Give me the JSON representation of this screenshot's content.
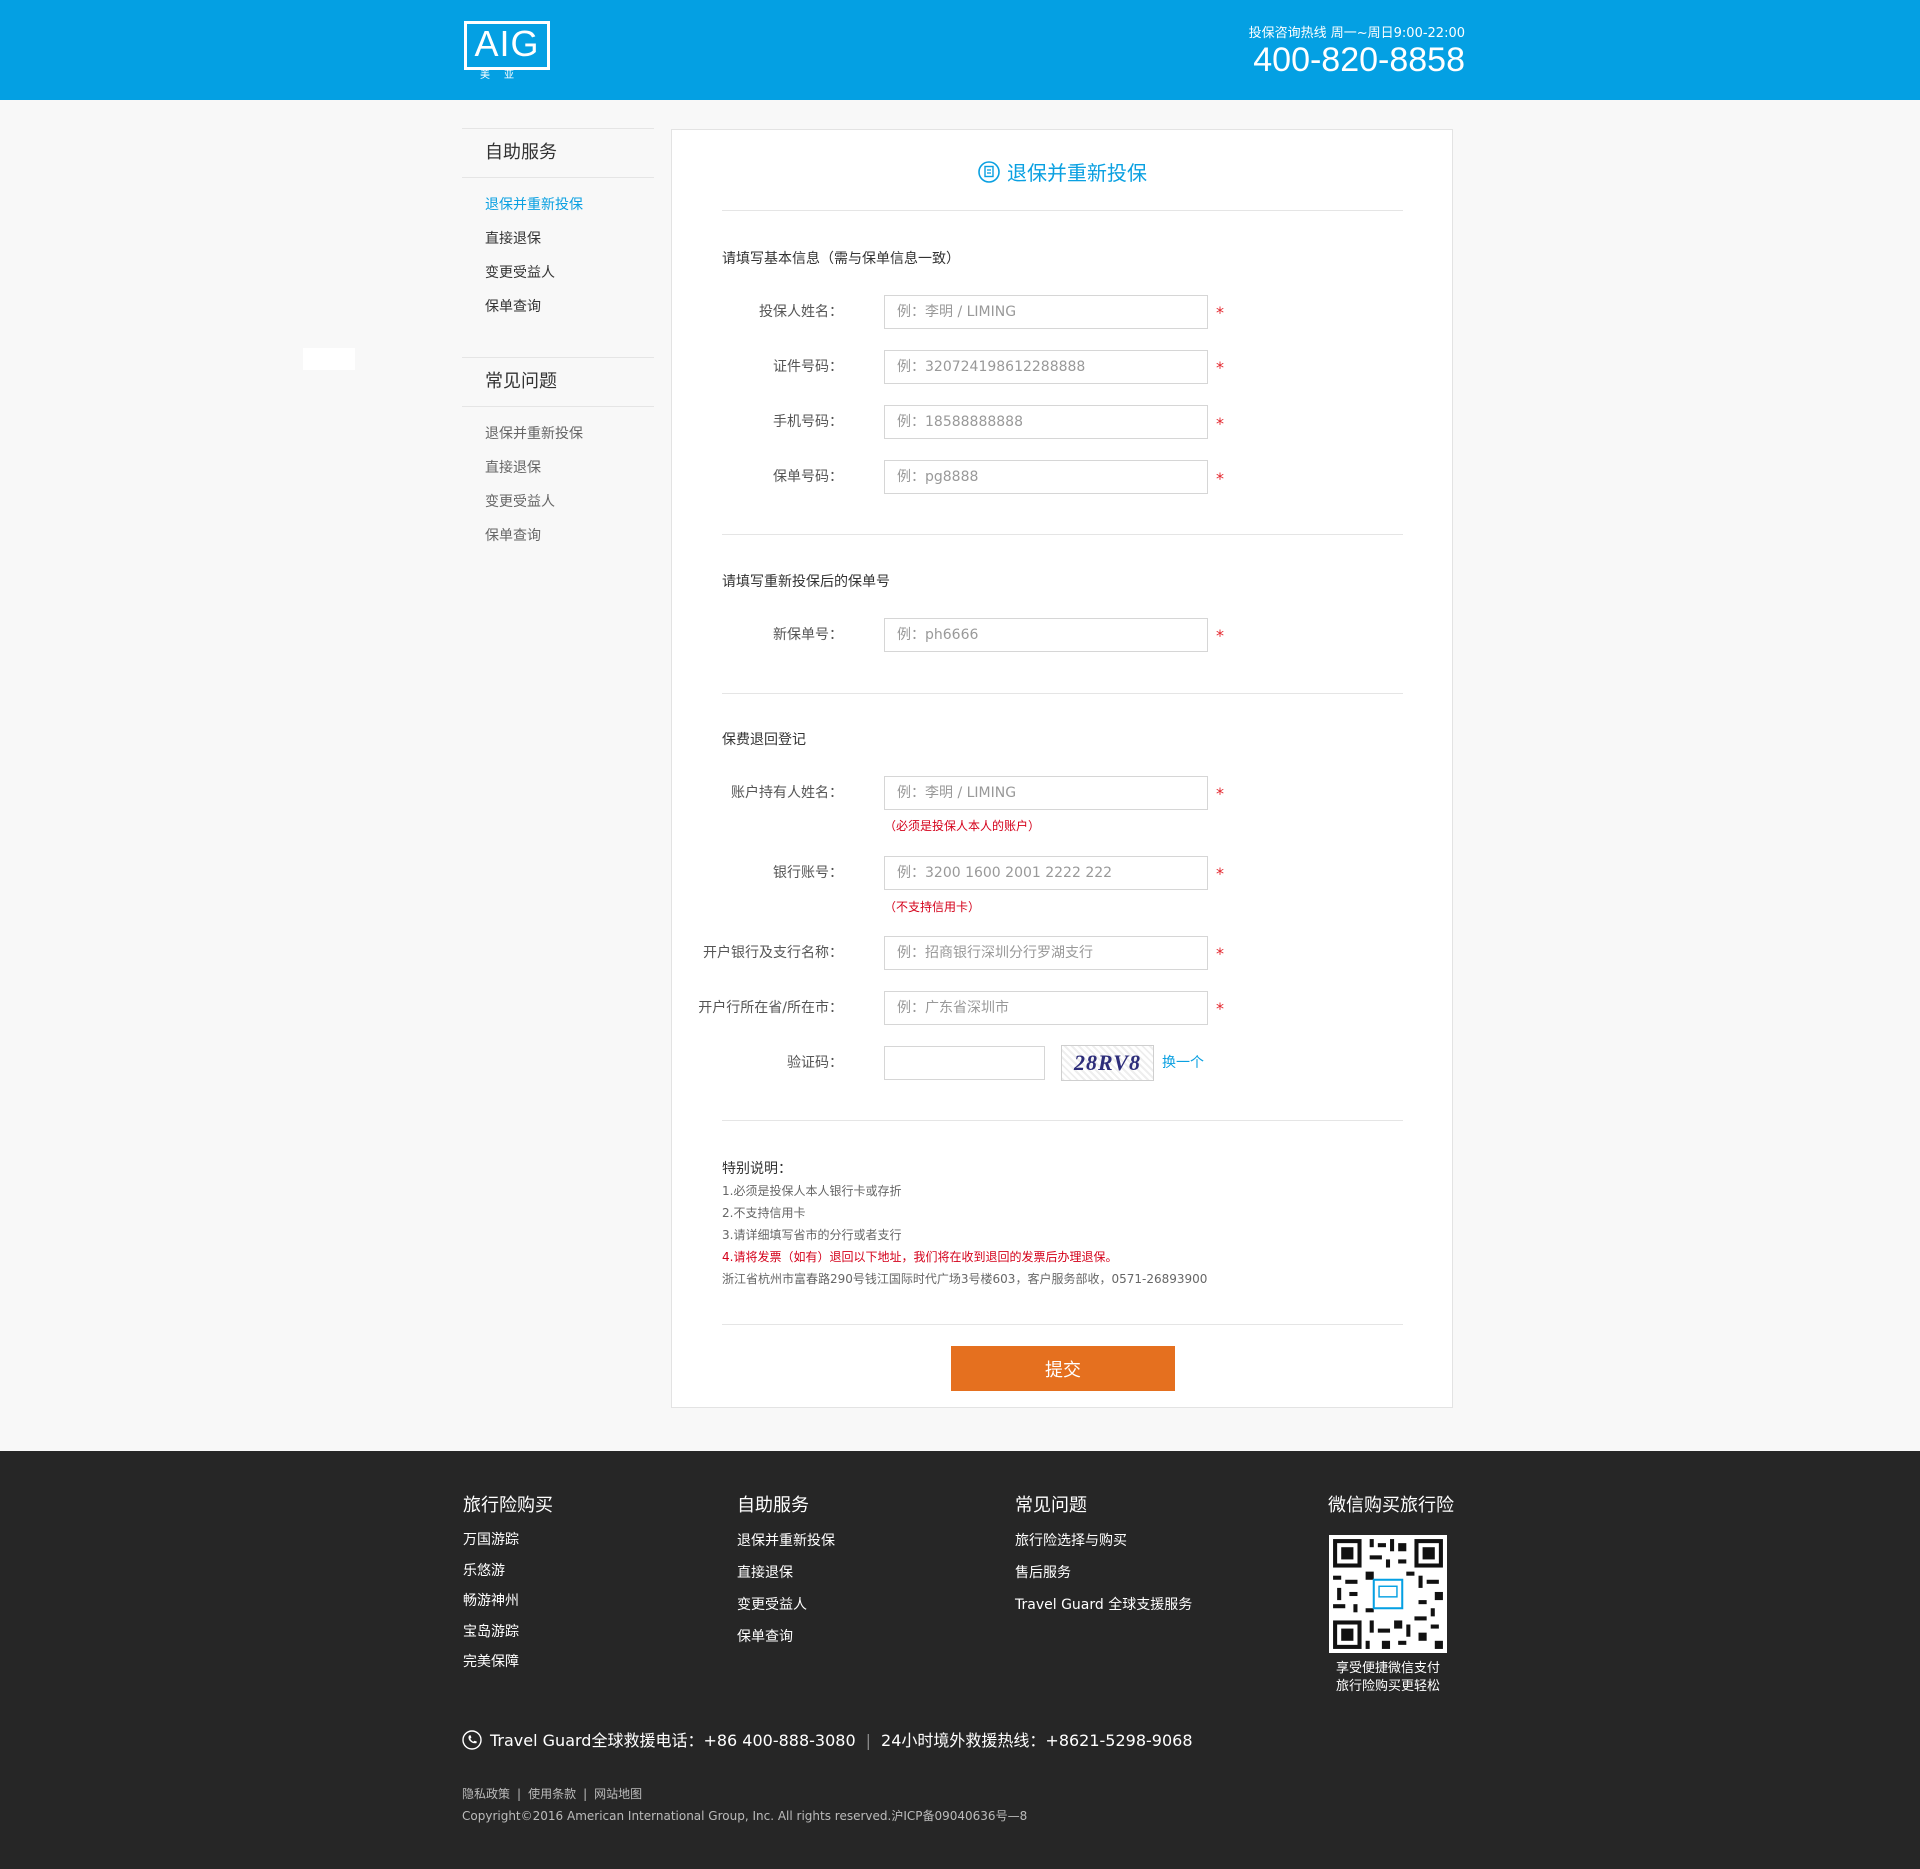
{
  "header": {
    "logo_text": "AIG",
    "logo_sub": "美亚",
    "hotline_label": "投保咨询热线 周一~周日9:00-22:00",
    "hotline_number": "400-820-8858"
  },
  "sidebar": {
    "self_service": {
      "title": "自助服务",
      "items": [
        "退保并重新投保",
        "直接退保",
        "变更受益人",
        "保单查询"
      ]
    },
    "faq": {
      "title": "常见问题",
      "items": [
        "退保并重新投保",
        "直接退保",
        "变更受益人",
        "保单查询"
      ]
    }
  },
  "form": {
    "title": "退保并重新投保",
    "basic_section": "请填写基本信息（需与保单信息一致）",
    "fields_basic": [
      {
        "label": "投保人姓名：",
        "placeholder": "例：李明 / LIMING",
        "required": "*"
      },
      {
        "label": "证件号码：",
        "placeholder": "例：320724198612288888",
        "required": "*"
      },
      {
        "label": "手机号码：",
        "placeholder": "例：18588888888",
        "required": "*"
      },
      {
        "label": "保单号码：",
        "placeholder": "例：pg8888",
        "required": "*"
      }
    ],
    "new_policy_section": "请填写重新投保后的保单号",
    "field_new_policy": {
      "label": "新保单号：",
      "placeholder": "例：ph6666",
      "required": "*"
    },
    "refund_section": "保费退回登记",
    "fields_refund": [
      {
        "label": "账户持有人姓名：",
        "placeholder": "例：李明 / LIMING",
        "required": "*",
        "hint": "（必须是投保人本人的账户）"
      },
      {
        "label": "银行账号：",
        "placeholder": "例：3200 1600 2001 2222 222",
        "required": "*",
        "hint": "（不支持信用卡）"
      },
      {
        "label": "开户银行及支行名称：",
        "placeholder": "例：招商银行深圳分行罗湖支行",
        "required": "*"
      },
      {
        "label": "开户行所在省/所在市：",
        "placeholder": "例：广东省深圳市",
        "required": "*"
      }
    ],
    "captcha": {
      "label": "验证码：",
      "value": "",
      "image_text": "28RV8",
      "swap_label": "换一个"
    },
    "notes": {
      "title": "特别说明：",
      "items": [
        "1.必须是投保人本人银行卡或存折",
        "2.不支持信用卡",
        "3.请详细填写省市的分行或者支行"
      ],
      "highlight": "4.请将发票（如有）退回以下地址，我们将在收到退回的发票后办理退保。",
      "address": "浙江省杭州市富春路290号钱江国际时代广场3号楼603，客户服务部收，0571-26893900"
    },
    "submit_label": "提交"
  },
  "footer": {
    "travel": {
      "title": "旅行险购买",
      "items": [
        "万国游踪",
        "乐悠游",
        "畅游神州",
        "宝岛游踪",
        "完美保障"
      ]
    },
    "self_service": {
      "title": "自助服务",
      "items": [
        "退保并重新投保",
        "直接退保",
        "变更受益人",
        "保单查询"
      ]
    },
    "faq": {
      "title": "常见问题",
      "items": [
        "旅行险选择与购买",
        "售后服务",
        "Travel Guard 全球支援服务"
      ]
    },
    "wechat": {
      "title": "微信购买旅行险",
      "caption_1": "享受便捷微信支付",
      "caption_2": "旅行险购买更轻松"
    },
    "rescue_1": "Travel Guard全球救援电话：+86 400-888-3080",
    "rescue_sep": "|",
    "rescue_2": "24小时境外救援热线：+8621-5298-9068",
    "links": [
      "隐私政策",
      "使用条款",
      "网站地图"
    ],
    "link_sep": "|",
    "copyright": "Copyright©2016 American International Group, Inc. All rights reserved.沪ICP备09040636号—8"
  },
  "colors": {
    "brand_blue": "#04a0e3",
    "accent_orange": "#e5701f",
    "footer_bg": "#262626",
    "required_red": "#e4242b"
  }
}
